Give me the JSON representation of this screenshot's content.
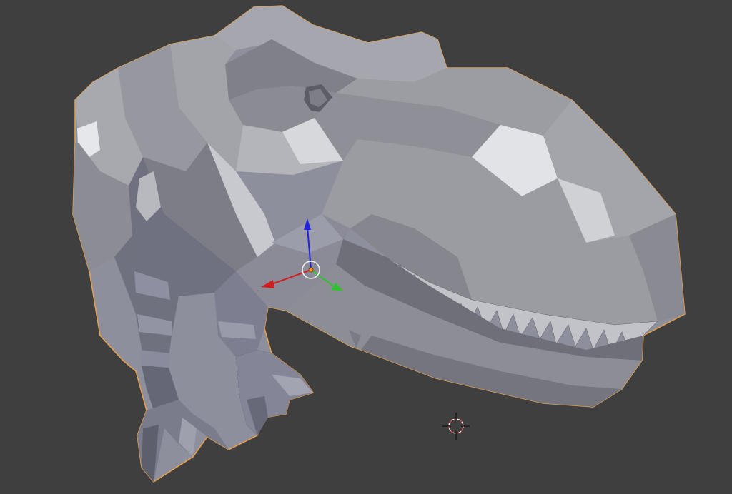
{
  "app": {
    "editor": "3D Viewport",
    "background_color": "#3f3f3f"
  },
  "scene": {
    "object": {
      "selected": true,
      "outline_color": "#e8a04a",
      "base_color": "#8e8f9c",
      "shading": "flat-solid",
      "icon": "dinosaur-mesh"
    },
    "gizmo": {
      "axes": [
        "x",
        "y",
        "z"
      ],
      "axis_colors": {
        "x": "#d21e1e",
        "y": "#2fc22f",
        "z": "#2222dd"
      },
      "icon": "transform-gizmo-icon"
    },
    "cursor": {
      "icon": "3d-cursor-icon",
      "colors": [
        "#ffffff",
        "#d84848"
      ]
    }
  }
}
